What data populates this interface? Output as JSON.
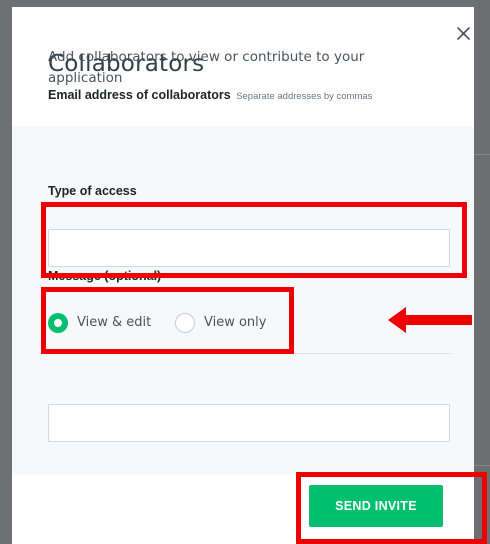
{
  "dialog": {
    "title": "Collaborators",
    "close_icon": "close-icon",
    "intro_text": "Add collaborators to view or contribute to your application"
  },
  "email": {
    "label": "Email address of collaborators",
    "hint": "Separate addresses by commas",
    "value": "",
    "placeholder": ""
  },
  "access": {
    "label": "Type of access",
    "options": [
      {
        "label": "View & edit",
        "checked": true
      },
      {
        "label": "View only",
        "checked": false
      }
    ]
  },
  "message": {
    "label": "Message (optional)",
    "value": "",
    "placeholder": ""
  },
  "actions": {
    "send_label": "SEND INVITE"
  },
  "colors": {
    "accent_green": "#00bf6f",
    "annotation_red": "#ee0000",
    "backdrop": "#6e7073",
    "body_bg": "#f7f8fa"
  }
}
